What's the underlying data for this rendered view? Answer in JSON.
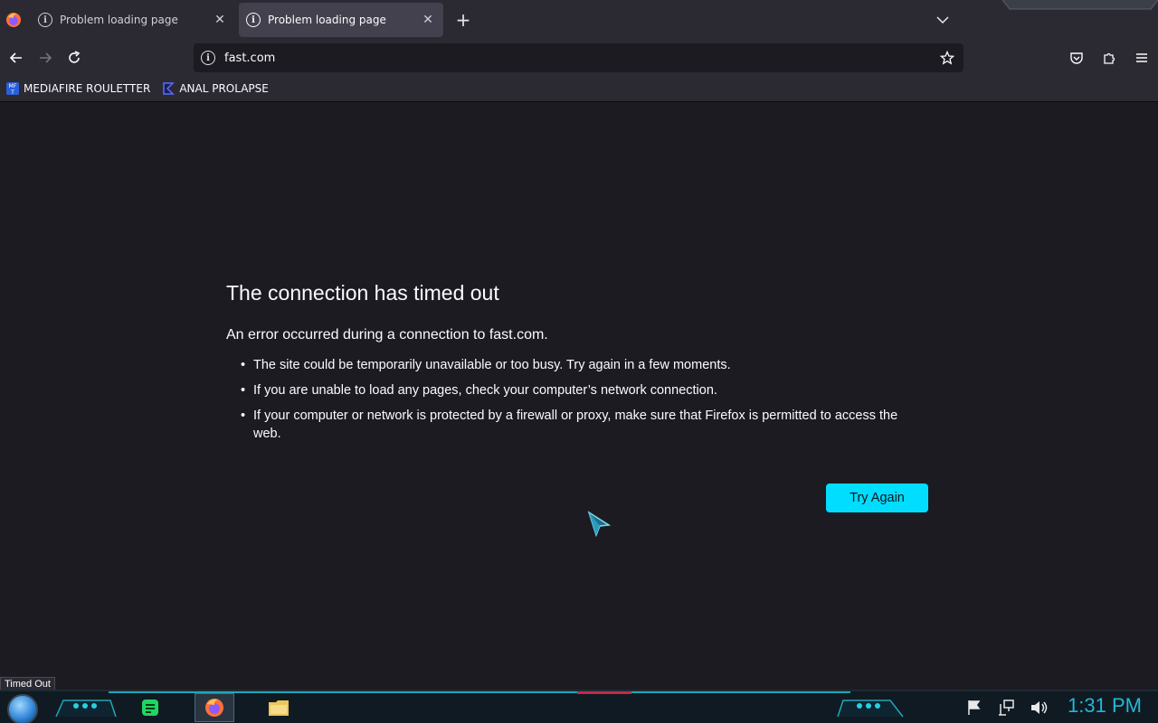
{
  "tabs": [
    {
      "title": "Problem loading page",
      "active": false
    },
    {
      "title": "Problem loading page",
      "active": true
    }
  ],
  "navbar": {
    "url": "fast.com"
  },
  "bookmarks": [
    {
      "label": "MEDIAFIRE ROULETTER",
      "icon": "mediafire-icon"
    },
    {
      "label": "ANAL PROLAPSE",
      "icon": "sigma-icon"
    }
  ],
  "error": {
    "title": "The connection has timed out",
    "description": "An error occurred during a connection to fast.com.",
    "items": [
      "The site could be temporarily unavailable or too busy. Try again in a few moments.",
      "If you are unable to load any pages, check your computer’s network connection.",
      "If your computer or network is protected by a firewall or proxy, make sure that Firefox is permitted to access the web."
    ],
    "button": "Try Again"
  },
  "status": "Timed Out",
  "taskbar": {
    "clock": "1:31 PM"
  },
  "colors": {
    "accent": "#00ddff",
    "background": "#1c1b22",
    "toolbar": "#2b2a33",
    "clock": "#22b8d8"
  }
}
